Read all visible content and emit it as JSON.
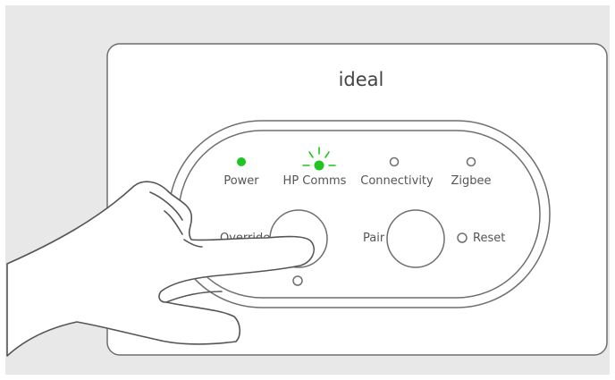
{
  "device": {
    "brand": "ideal",
    "indicators": [
      {
        "label": "Power",
        "state": "on",
        "color": "#22c422"
      },
      {
        "label": "HP Comms",
        "state": "flashing",
        "color": "#22c422"
      },
      {
        "label": "Connectivity",
        "state": "off"
      },
      {
        "label": "Zigbee",
        "state": "off"
      }
    ],
    "buttons": {
      "override_label": "Override",
      "pair_label": "Pair",
      "reset_label": "Reset"
    }
  },
  "colors": {
    "background": "#e8e8e8",
    "panel": "#ffffff",
    "outline": "#6e6e6e",
    "led_on": "#22c422",
    "text": "#555555"
  },
  "icons": [
    "led-power-icon",
    "led-hp-comms-icon",
    "led-connectivity-icon",
    "led-zigbee-icon",
    "flash-rays-icon",
    "hand-icon"
  ]
}
